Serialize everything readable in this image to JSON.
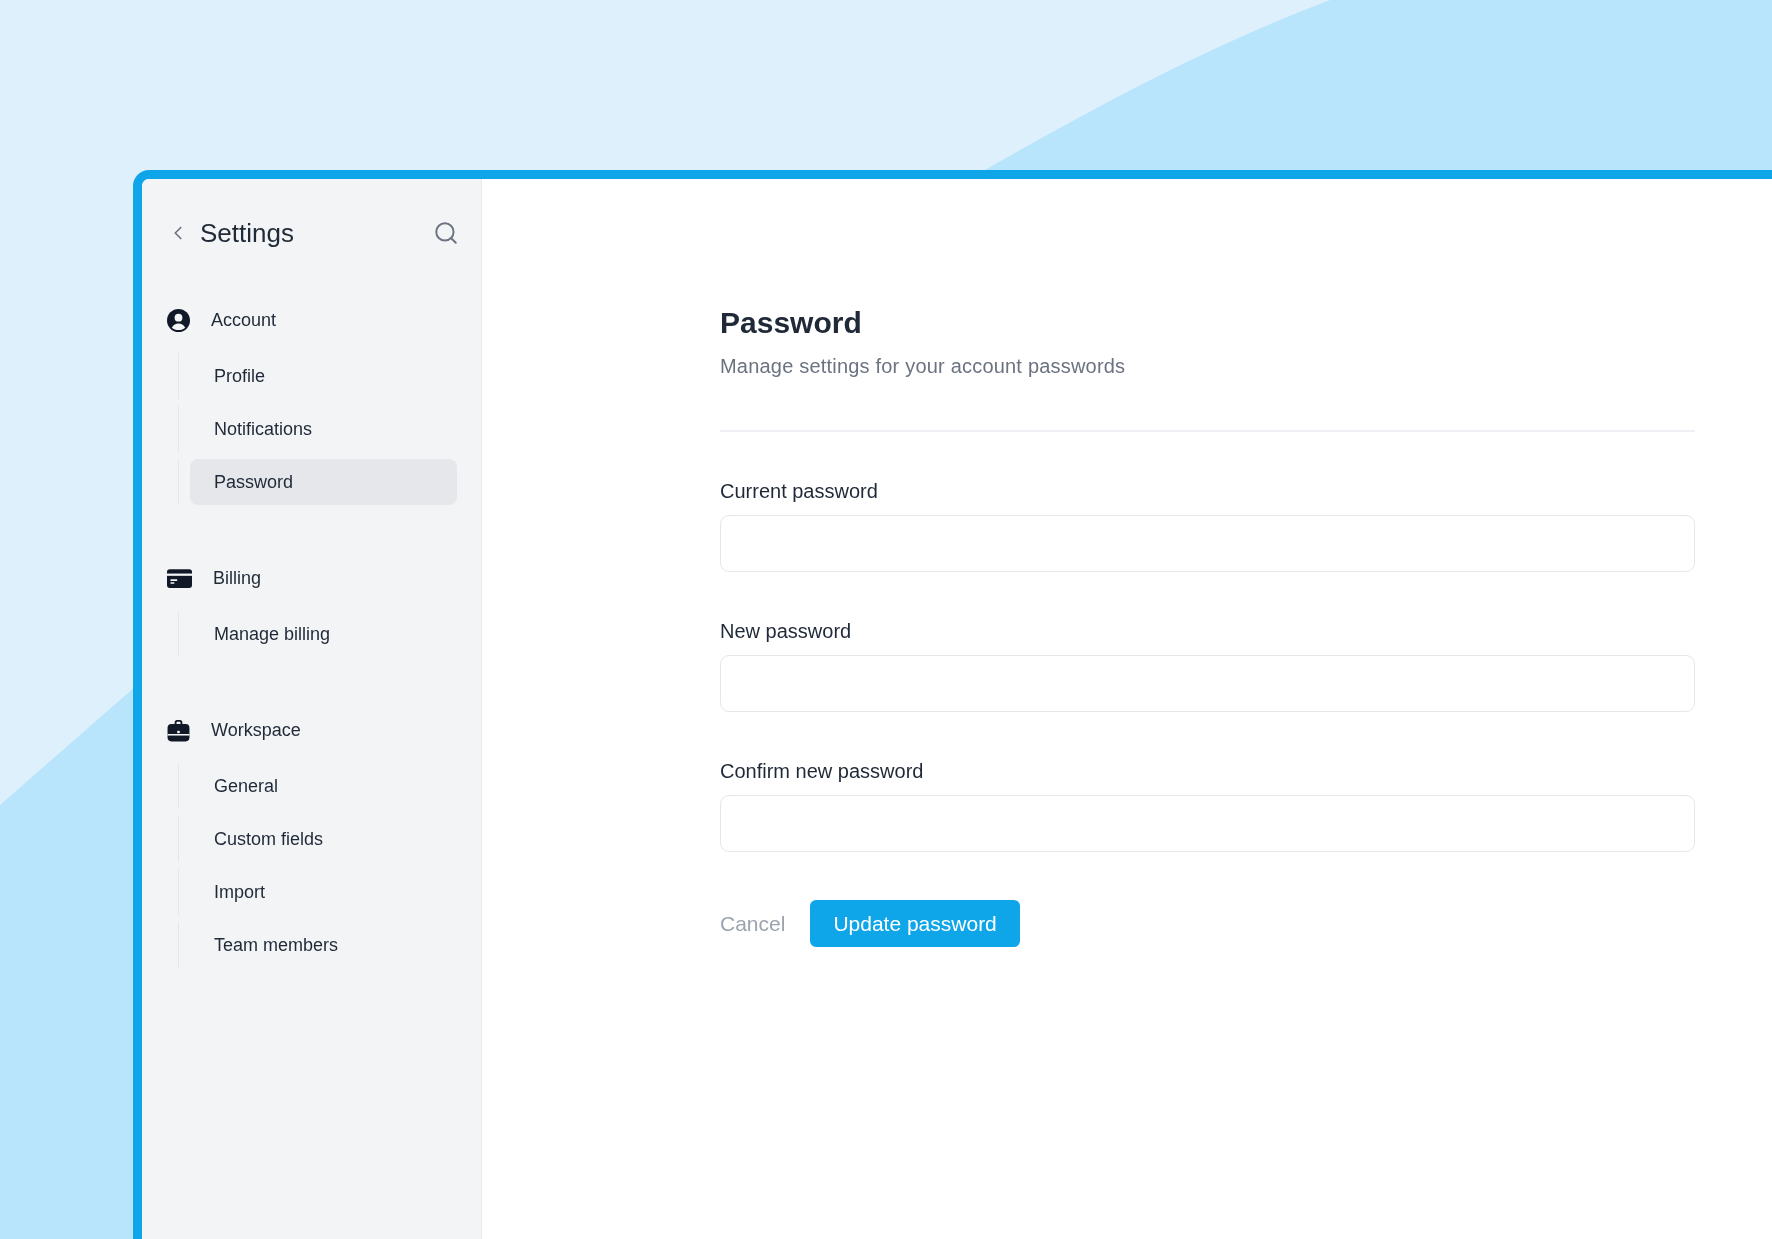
{
  "sidebar": {
    "title": "Settings",
    "sections": [
      {
        "label": "Account",
        "items": [
          {
            "label": "Profile",
            "selected": false
          },
          {
            "label": "Notifications",
            "selected": false
          },
          {
            "label": "Password",
            "selected": true
          }
        ]
      },
      {
        "label": "Billing",
        "items": [
          {
            "label": "Manage billing",
            "selected": false
          }
        ]
      },
      {
        "label": "Workspace",
        "items": [
          {
            "label": "General",
            "selected": false
          },
          {
            "label": "Custom fields",
            "selected": false
          },
          {
            "label": "Import",
            "selected": false
          },
          {
            "label": "Team members",
            "selected": false
          }
        ]
      }
    ]
  },
  "content": {
    "title": "Password",
    "subtitle": "Manage settings for your account passwords",
    "fields": [
      {
        "label": "Current password"
      },
      {
        "label": "New password"
      },
      {
        "label": "Confirm new password"
      }
    ],
    "actions": {
      "cancel": "Cancel",
      "submit": "Update password"
    }
  }
}
